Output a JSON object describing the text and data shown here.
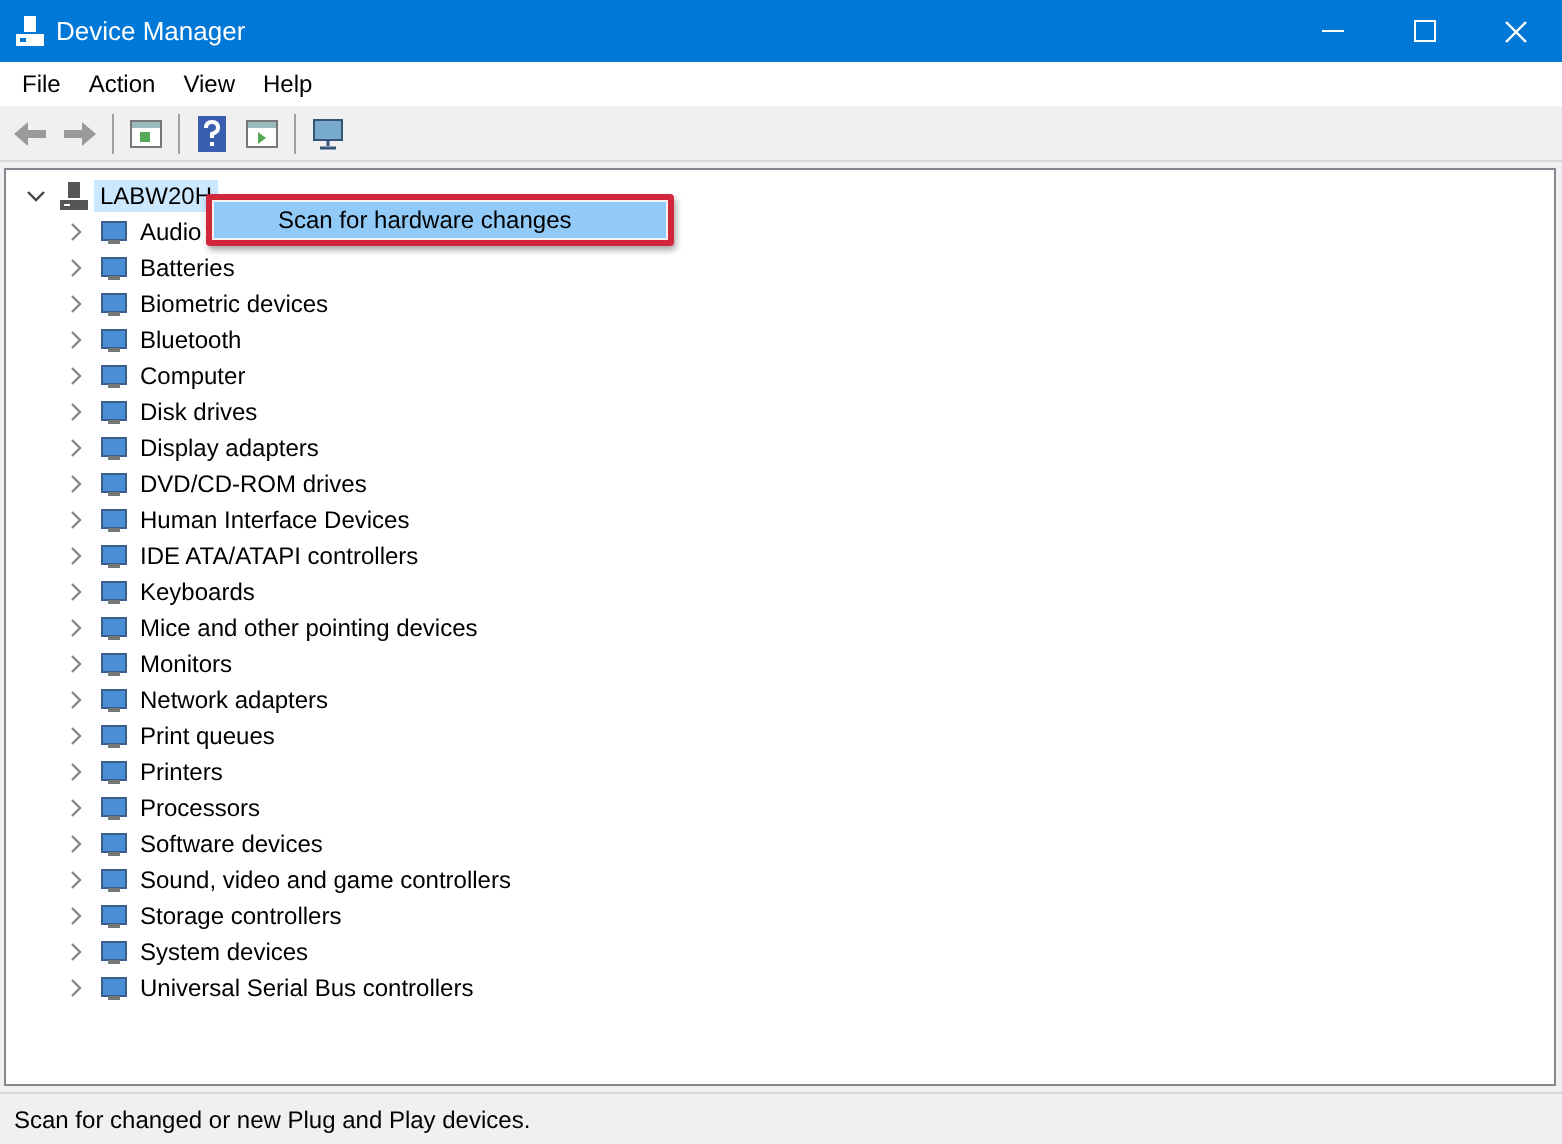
{
  "window": {
    "title": "Device Manager"
  },
  "menu_bar": [
    "File",
    "Action",
    "View",
    "Help"
  ],
  "tree": {
    "label": "LABW20H",
    "expanded": true,
    "selected": true,
    "children": [
      {
        "label": "Audio",
        "expanded": false
      },
      {
        "label": "Batteries",
        "expanded": false
      },
      {
        "label": "Biometric devices",
        "expanded": false
      },
      {
        "label": "Bluetooth",
        "expanded": false
      },
      {
        "label": "Computer",
        "expanded": false
      },
      {
        "label": "Disk drives",
        "expanded": false
      },
      {
        "label": "Display adapters",
        "expanded": false
      },
      {
        "label": "DVD/CD-ROM drives",
        "expanded": false
      },
      {
        "label": "Human Interface Devices",
        "expanded": false
      },
      {
        "label": "IDE ATA/ATAPI controllers",
        "expanded": false
      },
      {
        "label": "Keyboards",
        "expanded": false
      },
      {
        "label": "Mice and other pointing devices",
        "expanded": false
      },
      {
        "label": "Monitors",
        "expanded": false
      },
      {
        "label": "Network adapters",
        "expanded": false
      },
      {
        "label": "Print queues",
        "expanded": false
      },
      {
        "label": "Printers",
        "expanded": false
      },
      {
        "label": "Processors",
        "expanded": false
      },
      {
        "label": "Software devices",
        "expanded": false
      },
      {
        "label": "Sound, video and game controllers",
        "expanded": false
      },
      {
        "label": "Storage controllers",
        "expanded": false
      },
      {
        "label": "System devices",
        "expanded": false
      },
      {
        "label": "Universal Serial Bus controllers",
        "expanded": false
      }
    ]
  },
  "context_menu": {
    "items": [
      {
        "label": "Scan for hardware changes",
        "selected": true
      }
    ]
  },
  "status_bar": "Scan for changed or new Plug and Play devices."
}
